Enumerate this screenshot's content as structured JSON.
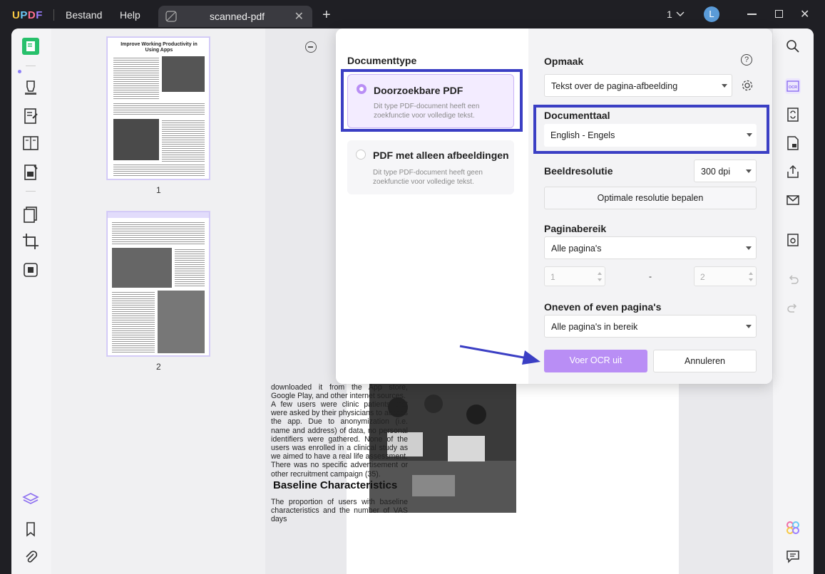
{
  "app": {
    "logo": "UPDF",
    "menu": [
      "Bestand",
      "Help"
    ],
    "tab_title": "scanned-pdf",
    "page_indicator": "1",
    "avatar_letter": "L"
  },
  "thumbnails": {
    "page1_num": "1",
    "page2_num": "2",
    "page1_title": "Improve Working Productivity in Using Apps"
  },
  "document": {
    "para1": "downloaded it from the App store, Google Play, and other internet sources.",
    "para2": "A few users were clinic patients that were asked by their physicians to access the app. Due to anonymization (i.e. name and address) of data, no personal identifiers were gathered. None of the users was enrolled in a clinical study as we aimed to have a real life assessment. There was no specific advertisement or other recruitment campaign (35).",
    "heading": "Baseline Characteristics",
    "para3": "The proportion of users with baseline characteristics and the number of VAS days"
  },
  "ocr_dialog": {
    "doc_type_title": "Documenttype",
    "opt1_title": "Doorzoekbare PDF",
    "opt1_desc": "Dit type PDF-document heeft een zoekfunctie voor volledige tekst.",
    "opt2_title": "PDF met alleen afbeeldingen",
    "opt2_desc": "Dit type PDF-document heeft geen zoekfunctie voor volledige tekst.",
    "layout_title": "Opmaak",
    "layout_value": "Tekst over de pagina-afbeelding",
    "lang_title": "Documenttaal",
    "lang_value": "English - Engels",
    "res_title": "Beeldresolutie",
    "res_value": "300 dpi",
    "res_button": "Optimale resolutie bepalen",
    "range_title": "Paginabereik",
    "range_value": "Alle pagina's",
    "range_from": "1",
    "range_dash": "-",
    "range_to": "2",
    "oddeven_title": "Oneven of even pagina's",
    "oddeven_value": "Alle pagina's in bereik",
    "run_button": "Voer OCR uit",
    "cancel_button": "Annuleren"
  },
  "colors": {
    "accent": "#b98ef5",
    "highlight": "#3b3fc4",
    "selected_card": "#f3ecff"
  }
}
